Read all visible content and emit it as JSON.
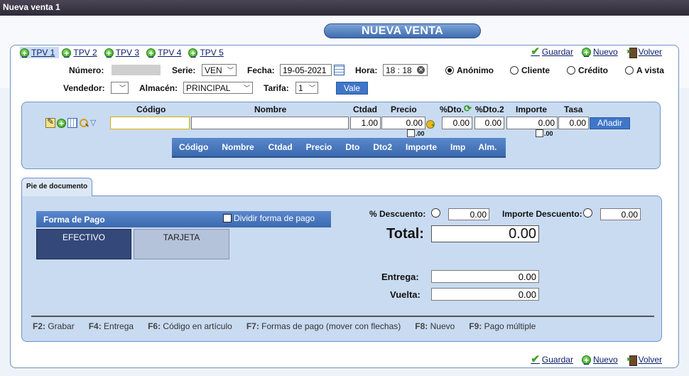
{
  "window": {
    "title": "Nueva venta 1"
  },
  "page_title": "NUEVA VENTA",
  "tabs": [
    {
      "label": "TPV 1",
      "active": true
    },
    {
      "label": "TPV 2"
    },
    {
      "label": "TPV 3"
    },
    {
      "label": "TPV 4"
    },
    {
      "label": "TPV 5"
    }
  ],
  "actions": {
    "save": "Guardar",
    "new": "Nuevo",
    "back": "Volver"
  },
  "header": {
    "numero_label": "Número:",
    "serie_label": "Serie:",
    "serie_value": "VEN",
    "fecha_label": "Fecha:",
    "fecha_value": "19-05-2021",
    "hora_label": "Hora:",
    "hora_value": "18 : 18",
    "client_types": [
      "Anónimo",
      "Cliente",
      "Crédito",
      "A vista"
    ],
    "client_type_selected": "Anónimo",
    "vendedor_label": "Vendedor:",
    "vendedor_value": "",
    "almacen_label": "Almacén:",
    "almacen_value": "PRINCIPAL",
    "tarifa_label": "Tarifa:",
    "tarifa_value": "1",
    "vale_button": "Vale"
  },
  "line_entry": {
    "columns": {
      "codigo": "Código",
      "nombre": "Nombre",
      "ctdad": "Ctdad",
      "precio": "Precio",
      "dto": "%Dto.",
      "dto2": "%Dto.2",
      "importe": "Importe",
      "tasa": "Tasa"
    },
    "values": {
      "codigo": "",
      "nombre": "",
      "ctdad": "1.00",
      "precio": "0.00",
      "dto": "0.00",
      "dto2": "0.00",
      "importe": "0.00",
      "tasa": "0.00"
    },
    "decimals_label": ".00",
    "add_button": "Añadir"
  },
  "grid_headers": [
    "Código",
    "Nombre",
    "Ctdad",
    "Precio",
    "Dto",
    "Dto2",
    "Importe",
    "Imp",
    "Alm."
  ],
  "footer": {
    "tab_label": "Pie de documento",
    "payment": {
      "title": "Forma de Pago",
      "split_label": "Dividir forma de pago",
      "options": [
        "EFECTIVO",
        "TARJETA"
      ],
      "selected": "EFECTIVO"
    },
    "descuento_label": "% Descuento:",
    "descuento_value": "0.00",
    "importe_descuento_label": "Importe Descuento:",
    "importe_descuento_value": "0.00",
    "total_label": "Total:",
    "total_value": "0.00",
    "entrega_label": "Entrega:",
    "entrega_value": "0.00",
    "vuelta_label": "Vuelta:",
    "vuelta_value": "0.00"
  },
  "shortcuts": [
    {
      "key": "F2:",
      "text": "Grabar"
    },
    {
      "key": "F4:",
      "text": "Entrega"
    },
    {
      "key": "F6:",
      "text": "Código en artículo"
    },
    {
      "key": "F7:",
      "text": "Formas de pago (mover con flechas)"
    },
    {
      "key": "F8:",
      "text": "Nuevo"
    },
    {
      "key": "F9:",
      "text": "Pago múltiple"
    }
  ],
  "colors": {
    "accent": "#3f76c9",
    "panel": "#c9dbf1",
    "selected_payment": "#34497a"
  }
}
